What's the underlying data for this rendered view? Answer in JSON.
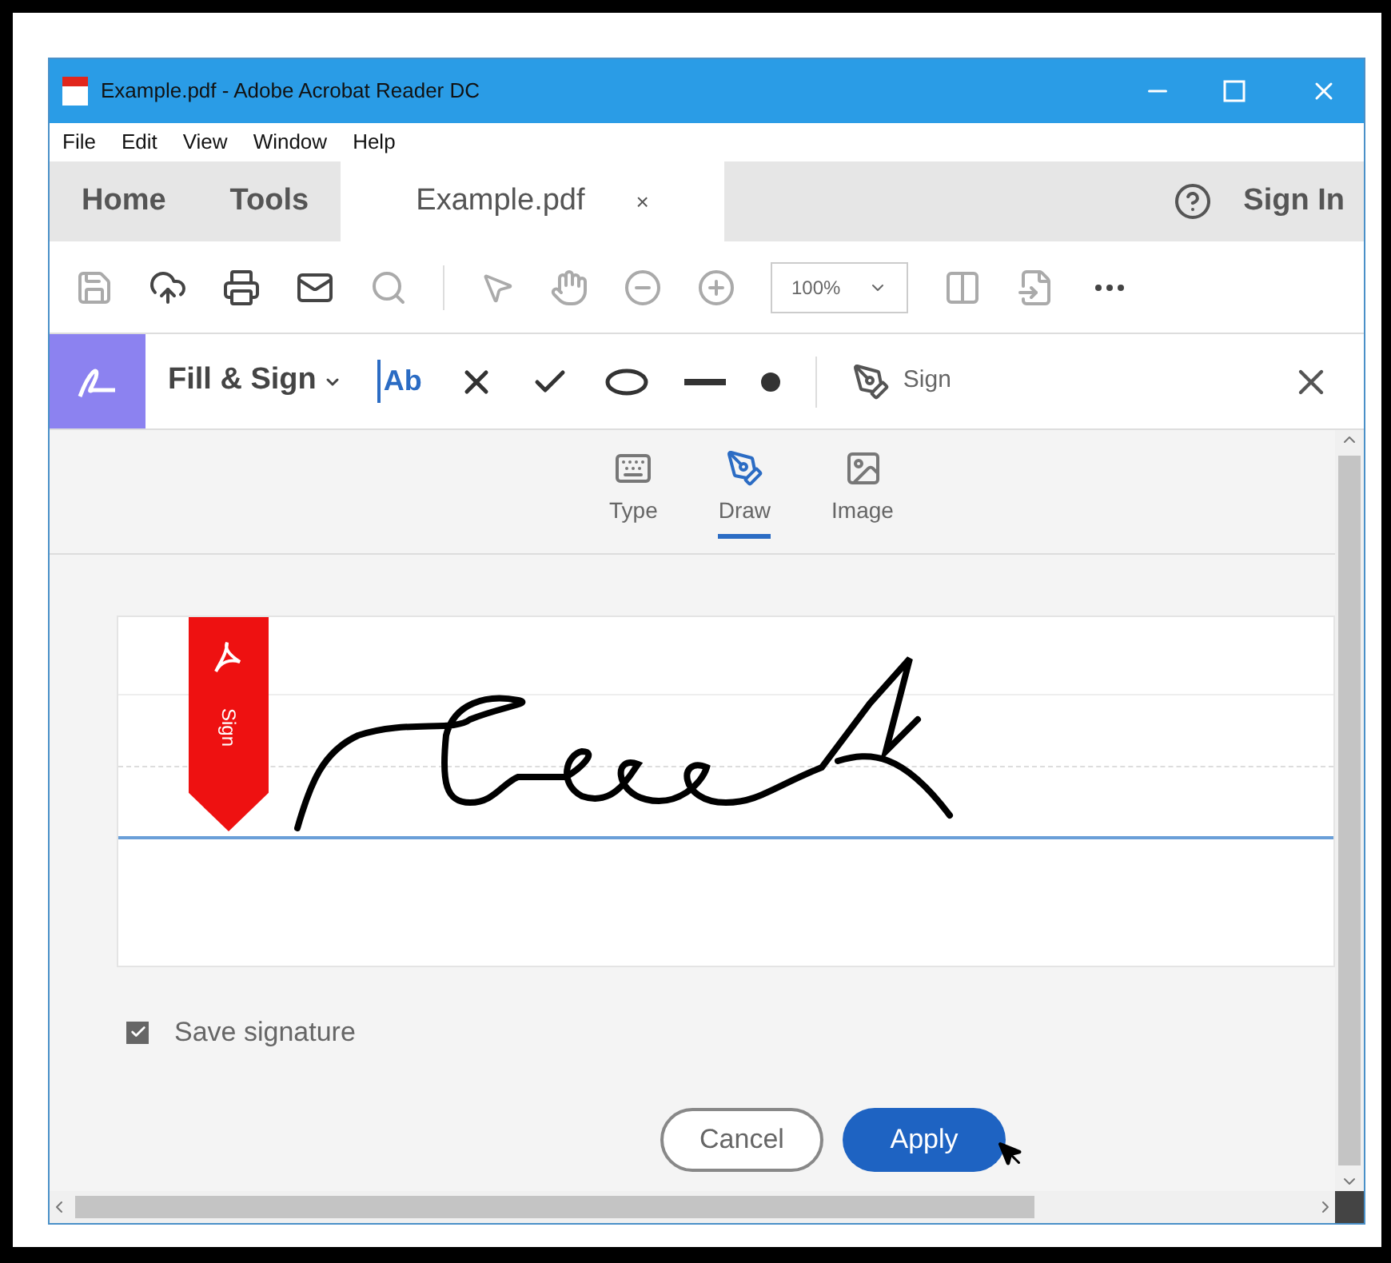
{
  "window": {
    "title": "Example.pdf - Adobe Acrobat Reader DC"
  },
  "menu": [
    "File",
    "Edit",
    "View",
    "Window",
    "Help"
  ],
  "tabs": [
    {
      "label": "Home",
      "selected": false
    },
    {
      "label": "Tools",
      "selected": false
    },
    {
      "label": "Example.pdf",
      "selected": true,
      "close": "×"
    }
  ],
  "sign_in": "Sign In",
  "zoom": "100%",
  "fill_sign": {
    "label": "Fill & Sign",
    "sign": "Sign",
    "tools": [
      {
        "kind": "text",
        "label": "Ab"
      },
      {
        "kind": "cross"
      },
      {
        "kind": "check"
      },
      {
        "kind": "ellipse"
      },
      {
        "kind": "line"
      },
      {
        "kind": "dot"
      }
    ]
  },
  "signature_tabs": [
    {
      "label": "Type",
      "kind": "keyboard",
      "selected": false
    },
    {
      "label": "Draw",
      "kind": "pen",
      "selected": true
    },
    {
      "label": "Image",
      "kind": "image",
      "selected": false
    }
  ],
  "signature_pad": {
    "flag": "Sign"
  },
  "save_signature": {
    "label": "Save signature",
    "checked": true
  },
  "buttons": [
    {
      "label": "Cancel",
      "kind": "secondary"
    },
    {
      "label": "Apply",
      "kind": "primary"
    }
  ]
}
